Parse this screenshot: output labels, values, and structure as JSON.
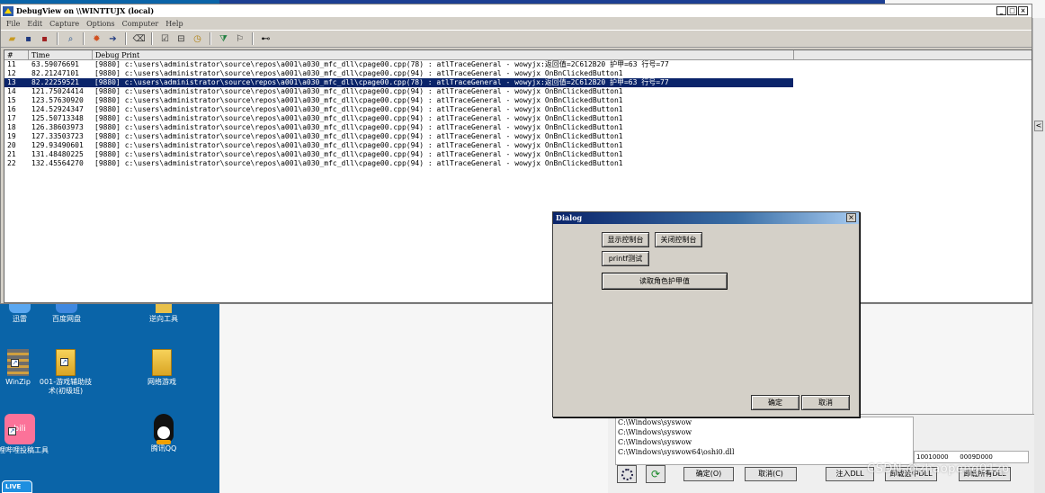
{
  "debugview": {
    "title": "DebugView on \\\\WINTTUJX (local)",
    "menu": [
      "File",
      "Edit",
      "Capture",
      "Options",
      "Computer",
      "Help"
    ],
    "columns": [
      "#",
      "Time",
      "Debug Print"
    ],
    "rows": [
      {
        "n": "11",
        "time": "63.59076691",
        "msg": "[9880] c:\\users\\administrator\\source\\repos\\a001\\a030_mfc_dll\\cpage00.cpp(78) : atlTraceGeneral - wowyjx:返回值=2C612B20 护甲=63 行号=77"
      },
      {
        "n": "12",
        "time": "82.21247101",
        "msg": "[9880] c:\\users\\administrator\\source\\repos\\a001\\a030_mfc_dll\\cpage00.cpp(94) : atlTraceGeneral - wowyjx OnBnClickedButton1"
      },
      {
        "n": "13",
        "time": "82.22259521",
        "msg": "[9880] c:\\users\\administrator\\source\\repos\\a001\\a030_mfc_dll\\cpage00.cpp(78) : atlTraceGeneral - wowyjx:返回值=2C612B20 护甲=63 行号=77"
      },
      {
        "n": "14",
        "time": "121.75024414",
        "msg": "[9880] c:\\users\\administrator\\source\\repos\\a001\\a030_mfc_dll\\cpage00.cpp(94) : atlTraceGeneral - wowyjx OnBnClickedButton1"
      },
      {
        "n": "15",
        "time": "123.57630920",
        "msg": "[9880] c:\\users\\administrator\\source\\repos\\a001\\a030_mfc_dll\\cpage00.cpp(94) : atlTraceGeneral - wowyjx OnBnClickedButton1"
      },
      {
        "n": "16",
        "time": "124.52924347",
        "msg": "[9880] c:\\users\\administrator\\source\\repos\\a001\\a030_mfc_dll\\cpage00.cpp(94) : atlTraceGeneral - wowyjx OnBnClickedButton1"
      },
      {
        "n": "17",
        "time": "125.50713348",
        "msg": "[9880] c:\\users\\administrator\\source\\repos\\a001\\a030_mfc_dll\\cpage00.cpp(94) : atlTraceGeneral - wowyjx OnBnClickedButton1"
      },
      {
        "n": "18",
        "time": "126.38603973",
        "msg": "[9880] c:\\users\\administrator\\source\\repos\\a001\\a030_mfc_dll\\cpage00.cpp(94) : atlTraceGeneral - wowyjx OnBnClickedButton1"
      },
      {
        "n": "19",
        "time": "127.33503723",
        "msg": "[9880] c:\\users\\administrator\\source\\repos\\a001\\a030_mfc_dll\\cpage00.cpp(94) : atlTraceGeneral - wowyjx OnBnClickedButton1"
      },
      {
        "n": "20",
        "time": "129.93490601",
        "msg": "[9880] c:\\users\\administrator\\source\\repos\\a001\\a030_mfc_dll\\cpage00.cpp(94) : atlTraceGeneral - wowyjx OnBnClickedButton1"
      },
      {
        "n": "21",
        "time": "131.48480225",
        "msg": "[9880] c:\\users\\administrator\\source\\repos\\a001\\a030_mfc_dll\\cpage00.cpp(94) : atlTraceGeneral - wowyjx OnBnClickedButton1"
      },
      {
        "n": "22",
        "time": "132.45564270",
        "msg": "[9880] c:\\users\\administrator\\source\\repos\\a001\\a030_mfc_dll\\cpage00.cpp(94) : atlTraceGeneral - wowyjx OnBnClickedButton1"
      }
    ],
    "selected_row": "13"
  },
  "dialog": {
    "title": "Dialog",
    "show_console": "显示控制台",
    "close_console": "关闭控制台",
    "printf_test": "printf测试",
    "read_armor": "读取角色护甲值",
    "ok": "确定",
    "cancel": "取消"
  },
  "desktop_icons": [
    {
      "label": "迅雷"
    },
    {
      "label": "百度网盘"
    },
    {
      "label": "逆向工具"
    },
    {
      "label": "WinZip"
    },
    {
      "label": "001-游戏辅助技术(初级班)"
    },
    {
      "label": "网络游戏"
    },
    {
      "label": "哔哩哔哩投稿工具"
    },
    {
      "label": "腾讯QQ"
    }
  ],
  "injector": {
    "paths": [
      "C:\\Windows\\syswow",
      "C:\\Windows\\syswow",
      "C:\\Windows\\syswow",
      "C:\\Windows\\syswow64\\oshi0.dll"
    ],
    "cells": [
      "10010000",
      "0009D000"
    ],
    "ok": "确定(O)",
    "cancel": "取消(C)",
    "inject": "注入DLL",
    "unload_selected": "卸载选中DLL",
    "unload_all": "卸载所有DLL"
  },
  "watermark": "CSDN @zhaopeng01zp",
  "colors": {
    "desktop": "#0a64a8",
    "selection": "#0a246a",
    "window": "#d4d0c8"
  }
}
